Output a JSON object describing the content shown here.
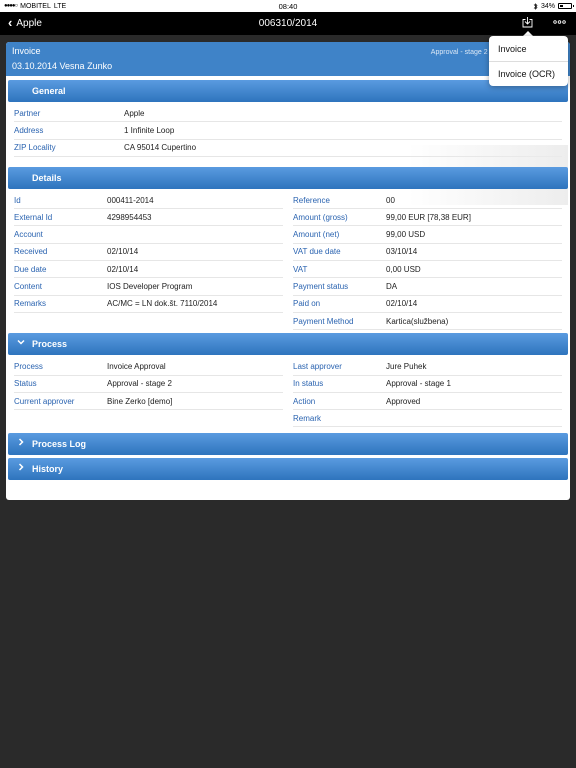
{
  "status_bar": {
    "signal_dots": "●●●●○",
    "carrier": "MOBITEL",
    "network": "LTE",
    "time": "08:40",
    "battery_percent_label": "34%",
    "battery_level": 0.34
  },
  "nav": {
    "back_label": "Apple",
    "title": "006310/2014",
    "icons": [
      "share-icon",
      "more-icon"
    ]
  },
  "dropdown": {
    "items": [
      {
        "label": "Invoice"
      },
      {
        "label": "Invoice (OCR)"
      }
    ]
  },
  "invoice": {
    "type": "Invoice",
    "subtitle": "03.10.2014 Vesna Zunko",
    "status": "Approval - stage 2 (Bin"
  },
  "general": {
    "title": "General",
    "rows": [
      {
        "label": "Partner",
        "value": "Apple"
      },
      {
        "label": "Address",
        "value": "1 Infinite Loop"
      },
      {
        "label": "ZIP Locality",
        "value": "CA 95014 Cupertino"
      }
    ]
  },
  "details": {
    "title": "Details",
    "left": [
      {
        "label": "Id",
        "value": "000411-2014"
      },
      {
        "label": "External Id",
        "value": "4298954453"
      },
      {
        "label": "Account",
        "value": ""
      },
      {
        "label": "Received",
        "value": "02/10/14"
      },
      {
        "label": "Due date",
        "value": "02/10/14"
      },
      {
        "label": "Content",
        "value": "IOS Developer Program"
      },
      {
        "label": "Remarks",
        "value": "AC/MC = LN dok.št. 7110/2014"
      }
    ],
    "right": [
      {
        "label": "Reference",
        "value": "00"
      },
      {
        "label": "Amount (gross)",
        "value": "99,00 EUR [78,38 EUR]"
      },
      {
        "label": "Amount (net)",
        "value": "99,00 USD"
      },
      {
        "label": "VAT due date",
        "value": "03/10/14"
      },
      {
        "label": "VAT",
        "value": "0,00 USD"
      },
      {
        "label": "Payment status",
        "value": "DA"
      },
      {
        "label": "Paid on",
        "value": "02/10/14"
      },
      {
        "label": "Payment Method",
        "value": "Kartica(službena)"
      }
    ]
  },
  "process": {
    "title": "Process",
    "left": [
      {
        "label": "Process",
        "value": "Invoice Approval"
      },
      {
        "label": "Status",
        "value": "Approval - stage 2"
      },
      {
        "label": "Current approver",
        "value": "Bine Zerko [demo]"
      }
    ],
    "right": [
      {
        "label": "Last approver",
        "value": "Jure Puhek"
      },
      {
        "label": "In status",
        "value": "Approval - stage 1"
      },
      {
        "label": "Action",
        "value": "Approved"
      },
      {
        "label": "Remark",
        "value": ""
      }
    ]
  },
  "process_log": {
    "title": "Process Log"
  },
  "history": {
    "title": "History"
  },
  "colors": {
    "section_blue": "#2e74bd",
    "header_blue": "#3f83c8",
    "label_blue": "#2a63b0",
    "background": "#2a2a2a"
  }
}
